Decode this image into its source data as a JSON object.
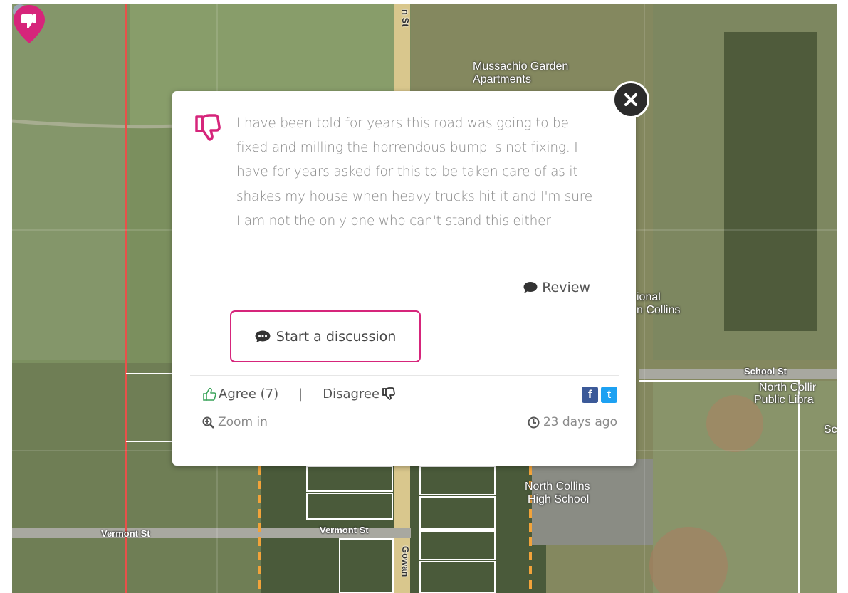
{
  "map": {
    "labels": {
      "garden_apartments_line1": "Mussachio Garden",
      "garden_apartments_line2": "Apartments",
      "national_partial_line1": "ional",
      "national_partial_line2": "n Collins",
      "school_st": "School St",
      "library_line1": "North Collir",
      "library_line2": "Public Libra",
      "sc_partial": "Sc",
      "high_school_line1": "North Collins",
      "high_school_line2": "High School",
      "vermont_st_left": "Vermont St",
      "vermont_st_right": "Vermont St",
      "gowanda_partial": "Gowan",
      "street_top": "n St"
    },
    "colors": {
      "pink": "#d6257b",
      "boundary_red": "#e8504a",
      "boundary_orange": "#f2a33a"
    }
  },
  "popup": {
    "vote_icon": "thumbs-down-icon",
    "comment": "I have been told for years this road was going to be fixed and milling the horrendous bump is not fixing. I have for years asked for this to be taken care of as it shakes my house when heavy trucks hit it and I'm sure I am not the only one who can't stand this either",
    "review_label": "Review",
    "discussion_button": "Start a discussion",
    "agree_label": "Agree (7)",
    "separator": "|",
    "disagree_label": "Disagree",
    "zoom_label": "Zoom in",
    "time_ago": "23 days ago",
    "social": {
      "facebook": "f",
      "twitter": "t"
    }
  }
}
